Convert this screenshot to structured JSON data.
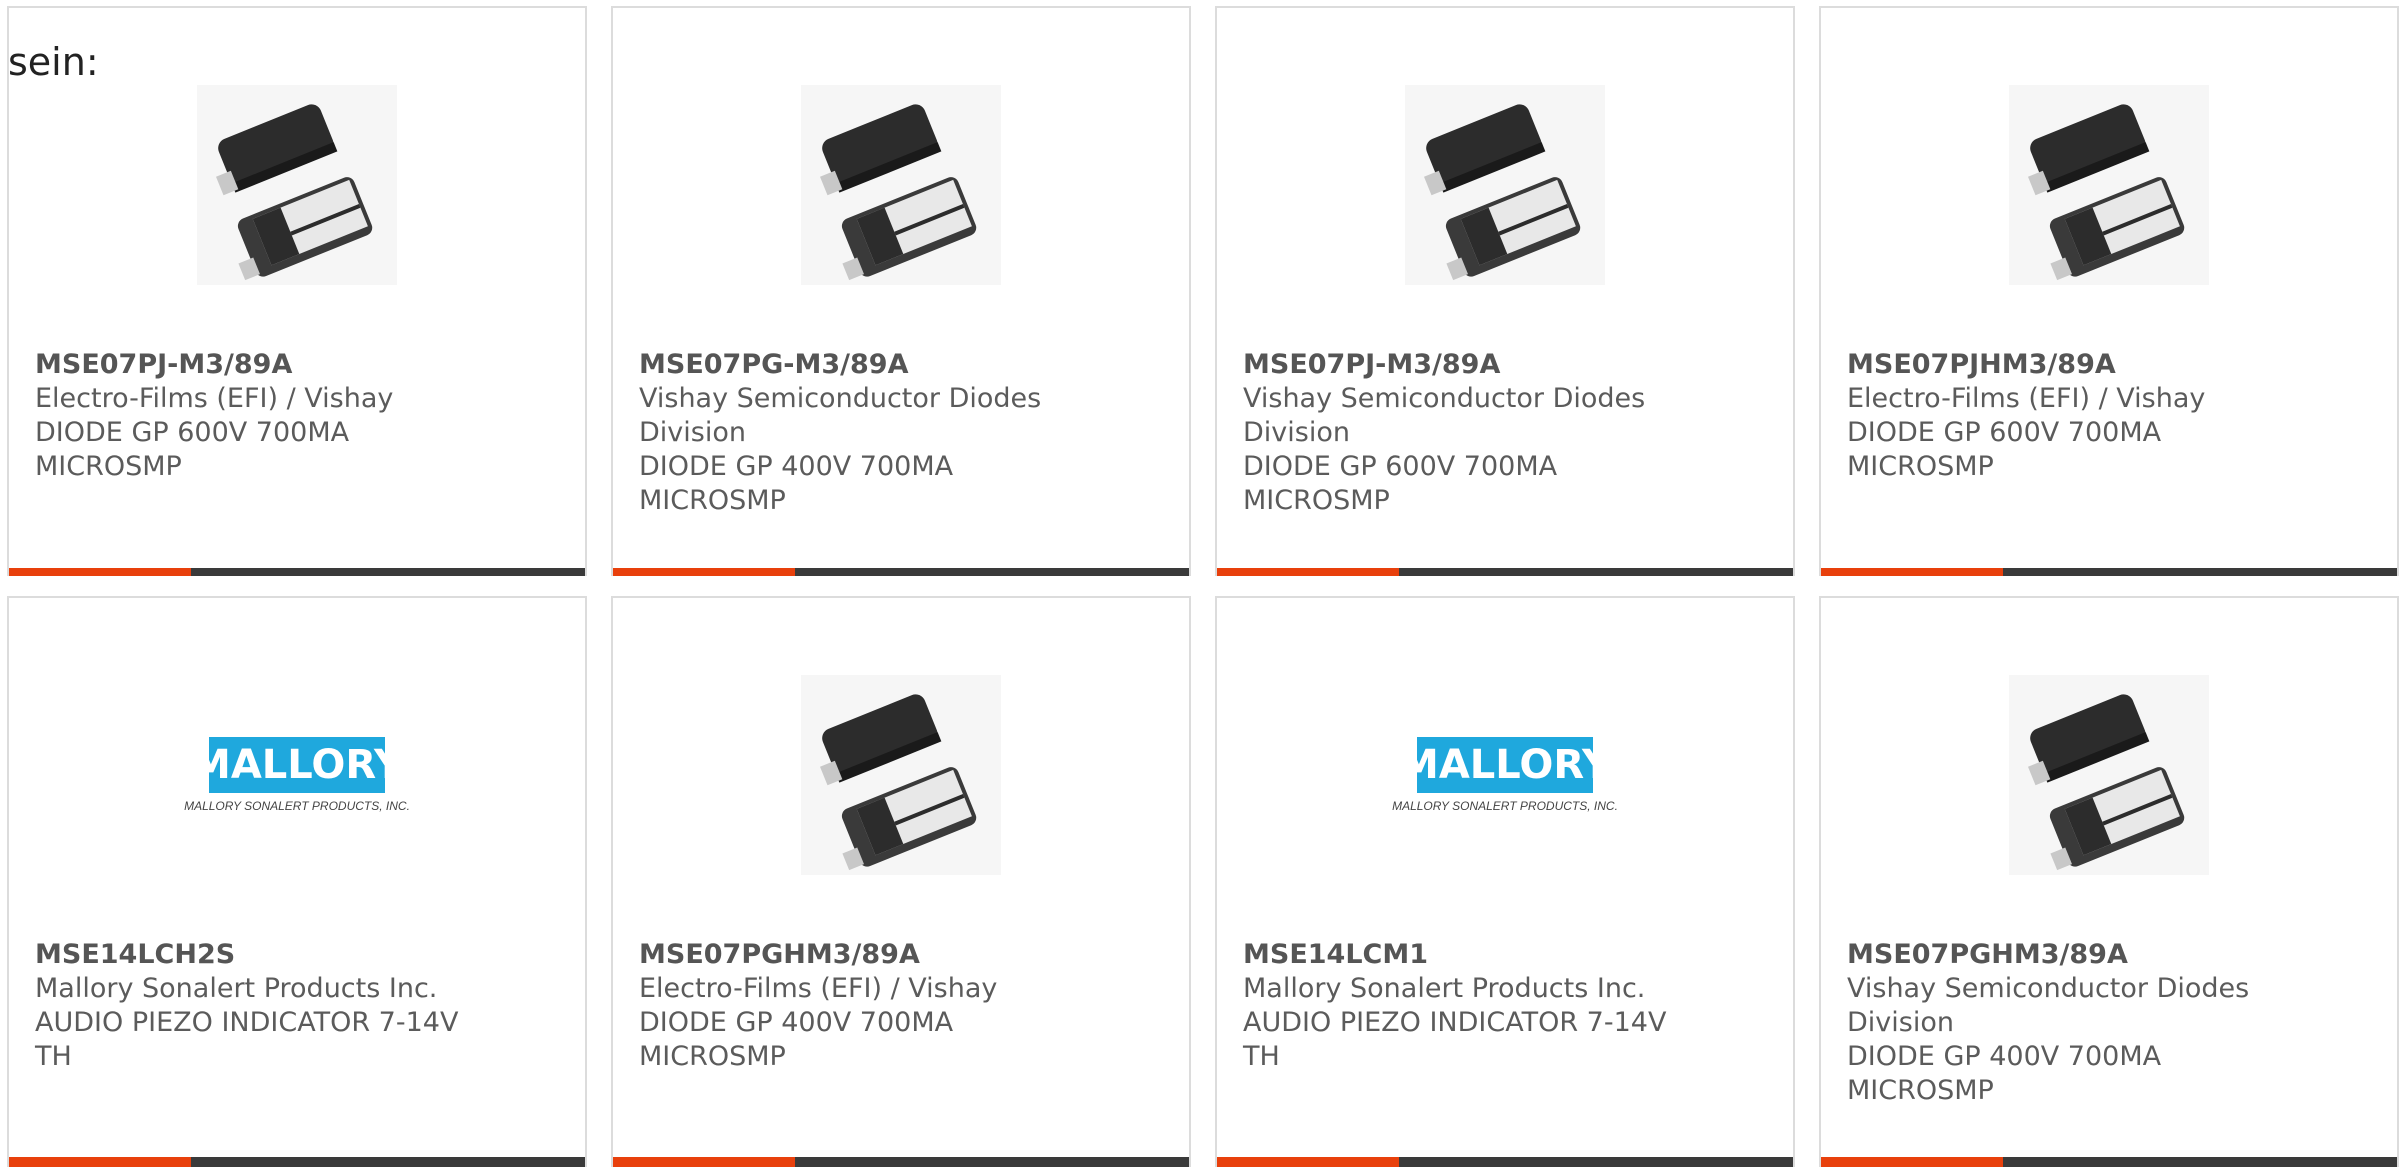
{
  "intro_text": "sein:",
  "products": [
    {
      "part_number": "MSE07PJ-M3/89A",
      "manufacturer": "Electro-Films (EFI) / Vishay",
      "description": "DIODE GP 600V 700MA MICROSMP",
      "image": "diode-icon"
    },
    {
      "part_number": "MSE07PG-M3/89A",
      "manufacturer": "Vishay Semiconductor Diodes Division",
      "description": "DIODE GP 400V 700MA MICROSMP",
      "image": "diode-icon"
    },
    {
      "part_number": "MSE07PJ-M3/89A",
      "manufacturer": "Vishay Semiconductor Diodes Division",
      "description": "DIODE GP 600V 700MA MICROSMP",
      "image": "diode-icon"
    },
    {
      "part_number": "MSE07PJHM3/89A",
      "manufacturer": "Electro-Films (EFI) / Vishay",
      "description": "DIODE GP 600V 700MA MICROSMP",
      "image": "diode-icon"
    },
    {
      "part_number": "MSE14LCH2S",
      "manufacturer": "Mallory Sonalert Products Inc.",
      "description": "AUDIO PIEZO INDICATOR 7-14V TH",
      "image": "mallory-logo"
    },
    {
      "part_number": "MSE07PGHM3/89A",
      "manufacturer": "Electro-Films (EFI) / Vishay",
      "description": "DIODE GP 400V 700MA MICROSMP",
      "image": "diode-icon"
    },
    {
      "part_number": "MSE14LCM1",
      "manufacturer": "Mallory Sonalert Products Inc.",
      "description": "AUDIO PIEZO INDICATOR 7-14V TH",
      "image": "mallory-logo"
    },
    {
      "part_number": "MSE07PGHM3/89A",
      "manufacturer": "Vishay Semiconductor Diodes Division",
      "description": "DIODE GP 400V 700MA MICROSMP",
      "image": "diode-icon"
    }
  ],
  "logo": {
    "brand": "MALLORY",
    "tagline": "MALLORY SONALERT PRODUCTS, INC."
  },
  "colors": {
    "accent": "#e8400c",
    "bar": "#3a3a3a",
    "logo_blue": "#1fa8dd"
  }
}
